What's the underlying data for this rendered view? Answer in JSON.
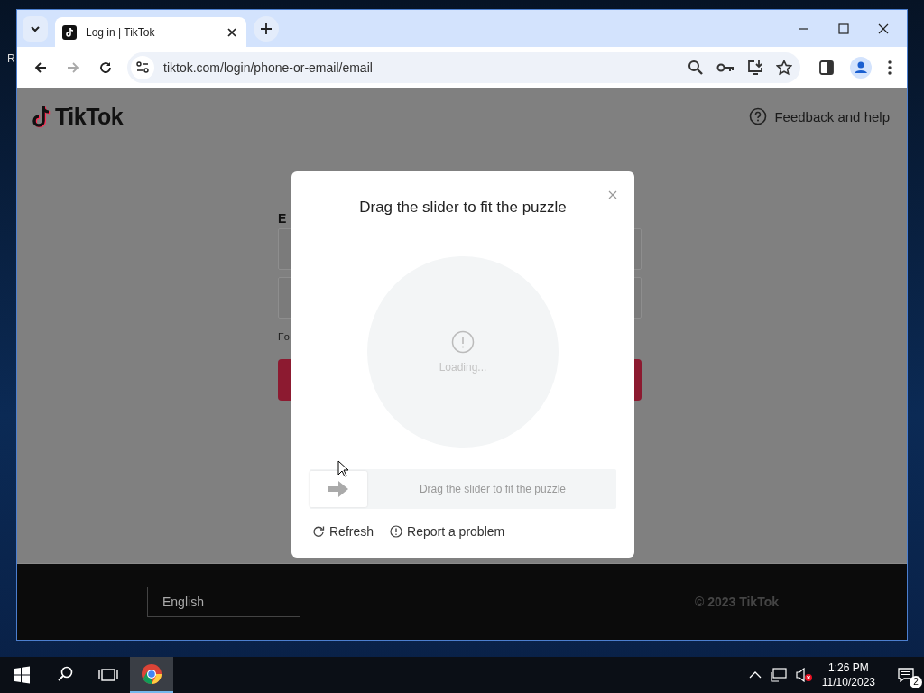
{
  "desktop": {
    "icon_label": "R"
  },
  "browser": {
    "tabs": [
      {
        "title": "Log in | TikTok",
        "selected": true
      }
    ],
    "address": "tiktok.com/login/phone-or-email/email"
  },
  "page": {
    "logo": "TikTok",
    "help_link": "Feedback and help",
    "form": {
      "label": "E",
      "note": "Fo"
    },
    "footer": {
      "language": "English",
      "copyright": "© 2023 TikTok"
    }
  },
  "captcha": {
    "title": "Drag the slider to fit the puzzle",
    "status": "Loading...",
    "slider": {
      "hint": "Drag the slider to fit the puzzle",
      "level": 0
    },
    "actions": [
      {
        "kind": "refresh",
        "label": "Refresh"
      },
      {
        "kind": "report",
        "label": "Report a problem"
      }
    ]
  },
  "taskbar": {
    "apps": [
      {
        "kind": "chrome",
        "selected": true
      }
    ],
    "time": "1:26 PM",
    "date": "11/10/2023",
    "notifications": "2"
  }
}
